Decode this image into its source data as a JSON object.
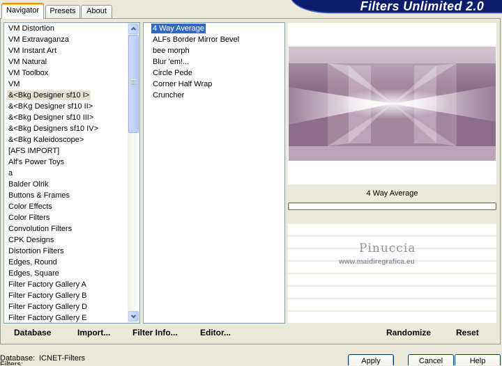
{
  "window": {
    "brand_title": "Filters Unlimited 2.0",
    "tabs": [
      {
        "label": "Navigator",
        "active": true
      },
      {
        "label": "Presets",
        "active": false
      },
      {
        "label": "About",
        "active": false
      }
    ]
  },
  "categories": {
    "items": [
      "VM Distortion",
      "VM Extravaganza",
      "VM Instant Art",
      "VM Natural",
      "VM Toolbox",
      "VM",
      "&<Bkg Designer sf10 I>",
      "&<BKg Designer sf10 II>",
      "&<Bkg Designer sf10 III>",
      "&<Bkg Designers sf10 IV>",
      "&<Bkg Kaleidoscope>",
      "[AFS IMPORT]",
      "Alf's Power Toys",
      "a",
      "Balder Olrik",
      "Buttons & Frames",
      "Color Effects",
      "Color Filters",
      "Convolution Filters",
      "CPK Designs",
      "Distortion Filters",
      "Edges, Round",
      "Edges, Square",
      "Filter Factory Gallery A",
      "Filter Factory Gallery B",
      "Filter Factory Gallery D",
      "Filter Factory Gallery E"
    ],
    "selected_index": 6
  },
  "filters": {
    "items": [
      "4 Way Average",
      "ALFs Border Mirror Bevel",
      "bee morph",
      "Blur 'em!...",
      "Circle Pede",
      "Corner Half Wrap",
      "Cruncher"
    ],
    "selected_index": 0
  },
  "preview": {
    "filter_name": "4 Way Average",
    "watermark": {
      "name": "Pinuccia",
      "url": "www.maidiregrafica.eu"
    },
    "image_colors": {
      "dark": "#8E6C8B",
      "mid": "#A4869F",
      "light": "#BCA3B8"
    }
  },
  "toolbar": {
    "database": "Database",
    "import": "Import...",
    "filter_info": "Filter Info...",
    "editor": "Editor...",
    "randomize": "Randomize",
    "reset": "Reset"
  },
  "status": {
    "database_label": "Database:",
    "database_value": "ICNET-Filters",
    "filters_label": "Filters:"
  },
  "dialog_buttons": {
    "apply": "Apply",
    "cancel": "Cancel",
    "help": "Help"
  },
  "icons": {
    "scroll_up": "chevron-up-icon",
    "scroll_down": "chevron-down-icon"
  },
  "colors": {
    "face": "#ECE9D8",
    "banner": "#0B1C6A",
    "banner_edge": "#3E5BC6",
    "selection": "#316AC5",
    "inactive_selection": "#E6E2D2",
    "list_border": "#7F9DB9",
    "tab_border": "#919B9C"
  }
}
